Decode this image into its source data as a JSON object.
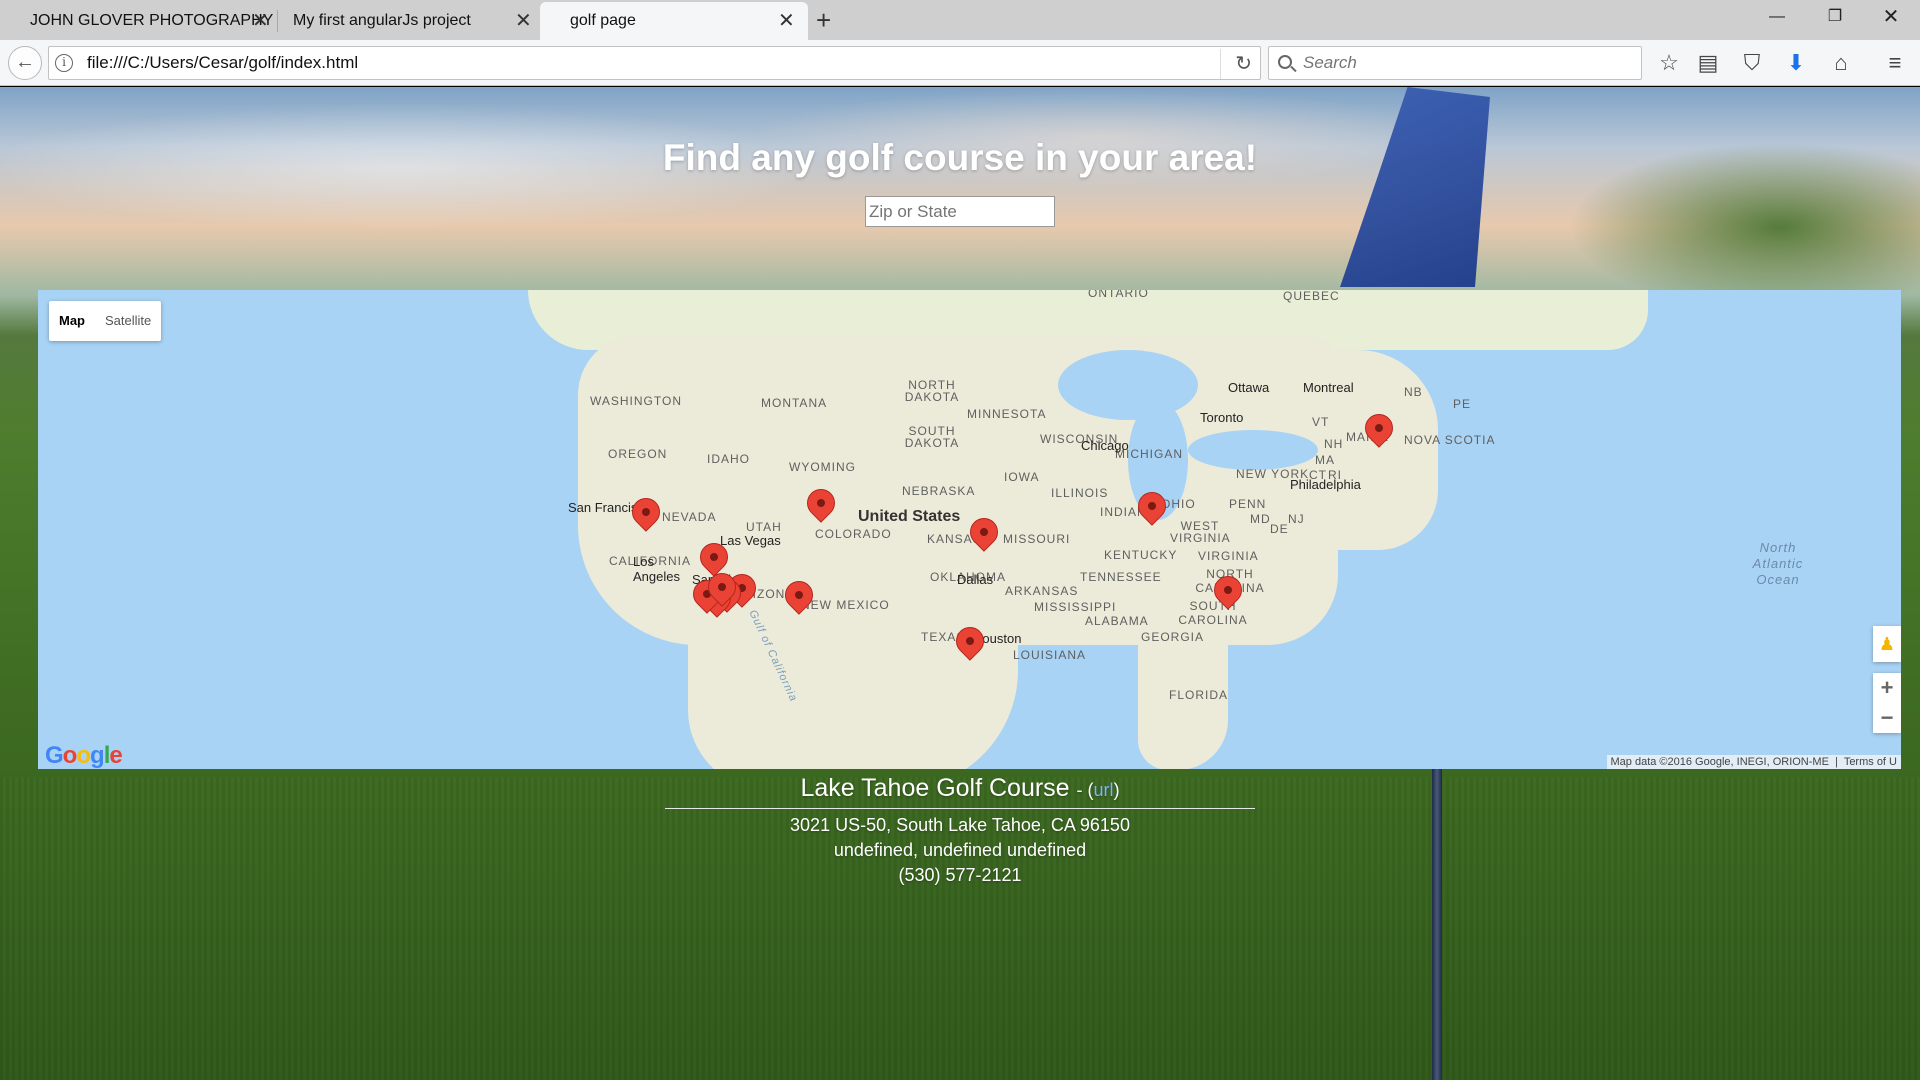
{
  "browser": {
    "tabs": [
      {
        "title": "JOHN GLOVER PHOTOGRAPHY"
      },
      {
        "title": "My first angularJs project"
      },
      {
        "title": "golf page",
        "active": true
      }
    ],
    "url": "file:///C:/Users/Cesar/golf/index.html",
    "search_placeholder": "Search",
    "icons": [
      "back-icon",
      "info-icon",
      "reload-icon",
      "search-icon",
      "bookmark-star-icon",
      "reading-list-icon",
      "pocket-icon",
      "downloads-icon",
      "home-icon",
      "menu-icon"
    ]
  },
  "hero": {
    "title": "Find any golf course in your area!",
    "input_placeholder": "Zip or State"
  },
  "map": {
    "type_control": {
      "map": "Map",
      "satellite": "Satellite",
      "selected": "Map"
    },
    "country_label": "United States",
    "region_labels": [
      "ONTARIO",
      "QUEBEC",
      "NB",
      "PE",
      "NOVA SCOTIA",
      "WASHINGTON",
      "MONTANA",
      "NORTH DAKOTA",
      "MINNESOTA",
      "OREGON",
      "IDAHO",
      "SOUTH DAKOTA",
      "WISCONSIN",
      "MICHIGAN",
      "WYOMING",
      "NEBRASKA",
      "IOWA",
      "ILLINOIS",
      "INDIANA",
      "OHIO",
      "NEVADA",
      "UTAH",
      "COLORADO",
      "KANSAS",
      "MISSOURI",
      "CALIFORNIA",
      "ARIZONA",
      "NEW MEXICO",
      "OKLAHOMA",
      "ARKANSAS",
      "TENNESSEE",
      "KENTUCKY",
      "WEST VIRGINIA",
      "VIRGINIA",
      "NORTH CAROLINA",
      "SOUTH CAROLINA",
      "MISSISSIPPI",
      "ALABAMA",
      "GEORGIA",
      "LOUISIANA",
      "TEXAS",
      "FLORIDA",
      "NEW YORK",
      "PENN",
      "VT",
      "NH",
      "MA",
      "CT",
      "RI",
      "MD",
      "DE",
      "NJ",
      "MAINE"
    ],
    "cities": [
      "Ottawa",
      "Montreal",
      "Toronto",
      "Chicago",
      "Philadelphia",
      "San Francisco",
      "Las Vegas",
      "Los Angeles",
      "San Diego",
      "Dallas",
      "Houston"
    ],
    "ocean_label": "North Atlantic Ocean",
    "gulf_label": "Gulf of California",
    "attribution": "Map data ©2016 Google, INEGI, ORION-ME",
    "terms": "Terms of U",
    "logo": "Google",
    "zoom_in": "+",
    "zoom_out": "−",
    "marker_count": 14
  },
  "result": {
    "name": "Lake Tahoe Golf Course",
    "separator": "- (",
    "link": "url",
    "close": ")",
    "address": "3021 US-50, South Lake Tahoe, CA 96150",
    "city_line": "undefined, undefined undefined",
    "phone": "(530) 577-2121"
  },
  "colors": {
    "marker": "#ea4335",
    "water": "#a9d3f5",
    "land": "#ecebd9",
    "link": "#7fb4ff"
  }
}
